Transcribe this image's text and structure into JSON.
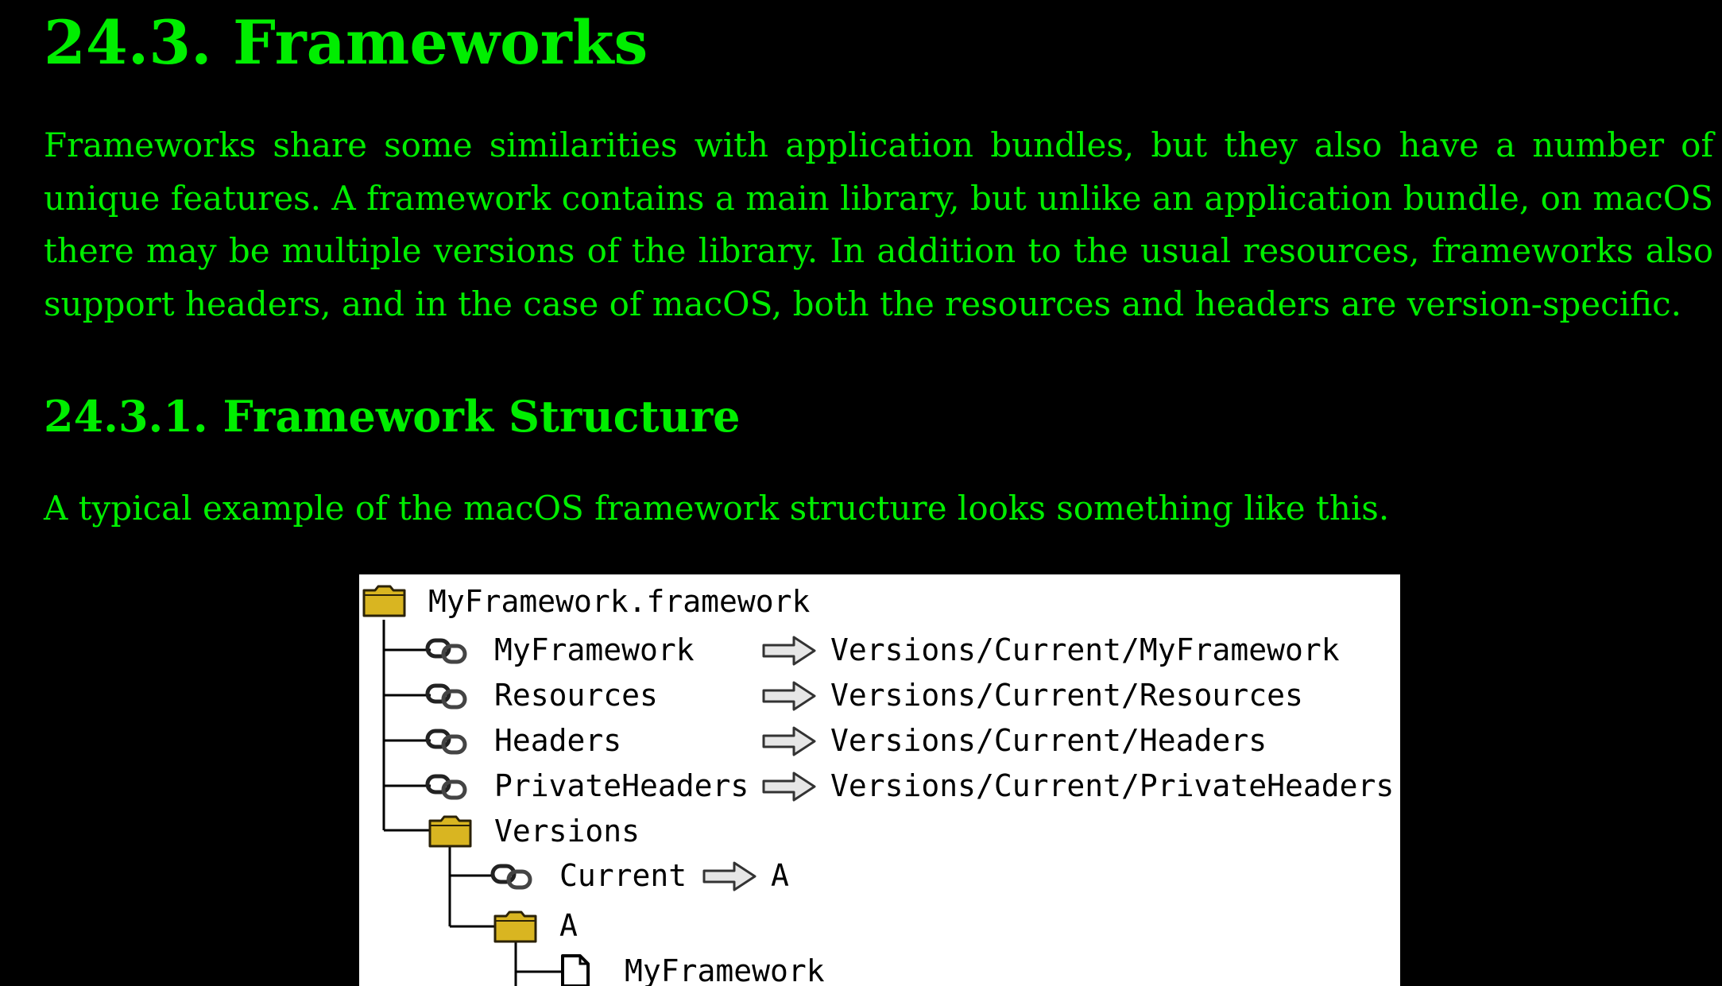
{
  "section": {
    "title": "24.3. Frameworks",
    "intro": "Frameworks share some similarities with application bundles, but they also have a number of unique features. A framework contains a main library, but unlike an application bundle, on macOS there may be multiple versions of the library. In addition to the usual resources, frameworks also support headers, and in the case of macOS, both the resources and headers are version-specific."
  },
  "subsection": {
    "title": "24.3.1. Framework Structure",
    "text": "A typical example of the macOS framework structure looks something like this."
  },
  "figure": {
    "root": "MyFramework.framework",
    "links": [
      {
        "name": "MyFramework",
        "target": "Versions/Current/MyFramework"
      },
      {
        "name": "Resources",
        "target": "Versions/Current/Resources"
      },
      {
        "name": "Headers",
        "target": "Versions/Current/Headers"
      },
      {
        "name": "PrivateHeaders",
        "target": "Versions/Current/PrivateHeaders"
      }
    ],
    "versions_folder": "Versions",
    "current_link": {
      "name": "Current",
      "target": "A"
    },
    "version_folder": "A",
    "library_file": "MyFramework",
    "icons": {
      "folder": "folder-icon",
      "link": "link-icon",
      "arrow": "arrow-right-icon",
      "file": "file-icon"
    },
    "colors": {
      "folder_fill": "#d9b521",
      "folder_stroke": "#2b2208"
    }
  },
  "colors": {
    "background": "#000000",
    "text": "#00ee00"
  }
}
